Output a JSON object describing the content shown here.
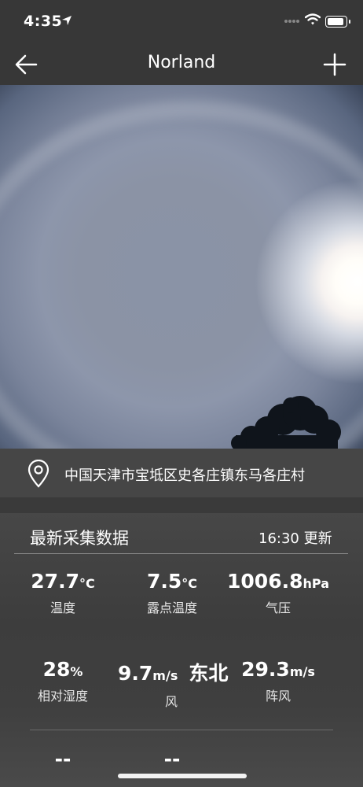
{
  "status_bar": {
    "time": "4:35"
  },
  "nav": {
    "title": "Norland",
    "back_icon": "arrow-left-icon",
    "add_icon": "plus-icon"
  },
  "location": {
    "address": "中国天津市宝坻区史各庄镇东马各庄村"
  },
  "panel": {
    "heading": "最新采集数据",
    "updated": "16:30 更新",
    "readings": [
      {
        "value": "27.7",
        "unit": "°C",
        "label": "温度"
      },
      {
        "value": "7.5",
        "unit": "°C",
        "label": "露点温度"
      },
      {
        "value": "1006.8",
        "unit": "hPa",
        "label": "气压"
      },
      {
        "value": "28",
        "unit": "%",
        "label": "相对湿度"
      },
      {
        "value": "9.7",
        "unit": "m/s",
        "direction": "东北",
        "label": "风"
      },
      {
        "value": "29.3",
        "unit": "m/s",
        "label": "阵风"
      }
    ],
    "row3": [
      {
        "value": "--"
      },
      {
        "value": "--"
      }
    ]
  }
}
